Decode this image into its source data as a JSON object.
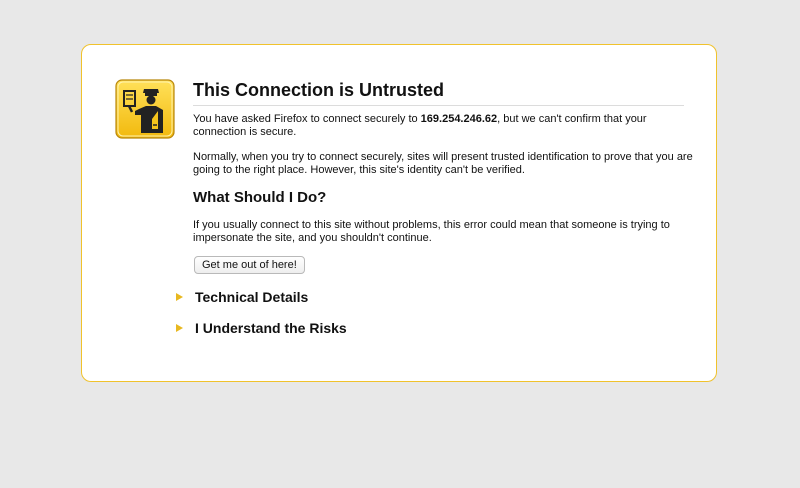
{
  "error_page": {
    "title": "This Connection is Untrusted",
    "intro_before_host": "You have asked Firefox to connect securely to ",
    "host": "169.254.246.62",
    "intro_after_host": ", but we can't confirm that your connection is secure.",
    "explanation": "Normally, when you try to connect securely, sites will present trusted identification to prove that you are going to the right place. However, this site's identity can't be verified.",
    "what_to_do_title": "What Should I Do?",
    "what_to_do_text": "If you usually connect to this site without problems, this error could mean that someone is trying to impersonate the site, and you shouldn't continue.",
    "escape_button": "Get me out of here!",
    "expanders": [
      {
        "label": "Technical Details"
      },
      {
        "label": "I Understand the Risks"
      }
    ],
    "icon": "security-officer-icon"
  },
  "colors": {
    "background": "#e8e8e8",
    "box_border": "#f0c22c",
    "icon_yellow": "#f5c41c",
    "arrow": "#e8b820"
  }
}
